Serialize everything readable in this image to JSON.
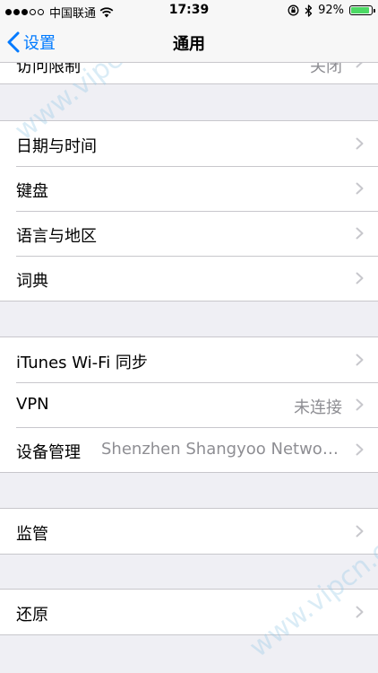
{
  "status_bar": {
    "carrier": "中国联通",
    "time": "17:39",
    "battery_percent": "92%",
    "battery_level": 0.92,
    "signal_bars_filled": 3,
    "signal_bars_total": 5,
    "icons": [
      "wifi-icon",
      "orientation-lock-icon",
      "bluetooth-icon",
      "battery-icon"
    ]
  },
  "nav": {
    "back_label": "设置",
    "title": "通用",
    "accent_color": "#007aff"
  },
  "partial_row": {
    "label": "访问限制",
    "value": "关闭"
  },
  "groups": [
    {
      "rows": [
        {
          "label": "日期与时间",
          "value": ""
        },
        {
          "label": "键盘",
          "value": ""
        },
        {
          "label": "语言与地区",
          "value": ""
        },
        {
          "label": "词典",
          "value": ""
        }
      ]
    },
    {
      "rows": [
        {
          "label": "iTunes Wi-Fi 同步",
          "value": ""
        },
        {
          "label": "VPN",
          "value": "未连接"
        },
        {
          "label": "设备管理",
          "value": "Shenzhen Shangyoo Network..."
        }
      ]
    },
    {
      "rows": [
        {
          "label": "监管",
          "value": ""
        }
      ]
    },
    {
      "rows": [
        {
          "label": "还原",
          "value": ""
        }
      ]
    }
  ],
  "watermarks": [
    "www.vipcn.com",
    "www.vipcn.com"
  ]
}
